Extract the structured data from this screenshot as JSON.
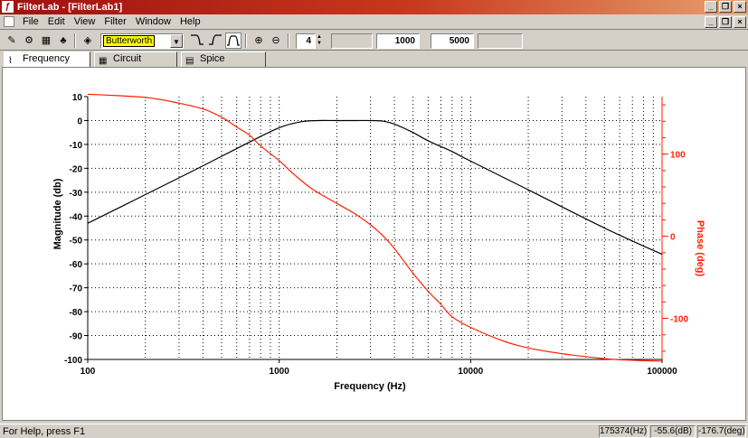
{
  "window": {
    "title": "FilterLab - [FilterLab1]",
    "controls": [
      "_",
      "❐",
      "×"
    ]
  },
  "menu": {
    "items": [
      "File",
      "Edit",
      "View",
      "Filter",
      "Window",
      "Help"
    ]
  },
  "toolbar": {
    "filter_type": "Butterworth",
    "order": "4",
    "low_freq": "1000",
    "high_freq": "5000"
  },
  "tabs": [
    {
      "label": "Frequency",
      "active": true
    },
    {
      "label": "Circuit",
      "active": false
    },
    {
      "label": "Spice",
      "active": false
    }
  ],
  "status": {
    "help": "For Help, press F1",
    "freq": "175374(Hz)",
    "mag": "-55.6(dB)",
    "phase": "-176.7(deg)"
  },
  "colors": {
    "magnitude": "#000000",
    "phase": "#ff2000",
    "grid": "#000000"
  },
  "chart_data": {
    "type": "line",
    "xlabel": "Frequency (Hz)",
    "ylabel": "Magnitude (db)",
    "y2label": "Phase (deg)",
    "xscale": "log",
    "xlim": [
      100,
      100000
    ],
    "ylim": [
      -100,
      10
    ],
    "y2lim": [
      -150,
      170
    ],
    "xticks": [
      100,
      1000,
      10000,
      100000
    ],
    "yticks": [
      10,
      0,
      -10,
      -20,
      -30,
      -40,
      -50,
      -60,
      -70,
      -80,
      -90,
      -100
    ],
    "y2ticks": [
      100,
      0,
      -100
    ],
    "grid": true,
    "series": [
      {
        "axis": "left",
        "color": "#000000",
        "x": [
          100,
          150,
          200,
          300,
          500,
          700,
          1000,
          1300,
          1600,
          2000,
          2500,
          3000,
          3500,
          4000,
          5000,
          6000,
          8000,
          10000,
          20000,
          50000,
          100000
        ],
        "y": [
          -43,
          -36,
          -31,
          -24,
          -15,
          -9,
          -3,
          -0.5,
          0,
          0,
          0,
          0,
          -0.3,
          -1.5,
          -5,
          -8.5,
          -13,
          -17,
          -29,
          -45,
          -56
        ]
      },
      {
        "axis": "right",
        "color": "#ff2000",
        "x": [
          100,
          200,
          300,
          400,
          500,
          600,
          700,
          800,
          1000,
          1200,
          1500,
          2000,
          2500,
          3000,
          3500,
          4000,
          5000,
          6000,
          7000,
          8000,
          10000,
          15000,
          20000,
          30000,
          50000,
          70000,
          100000
        ],
        "y": [
          173,
          169,
          162,
          155,
          145,
          133,
          123,
          110,
          92,
          75,
          57,
          40,
          27,
          14,
          0,
          -15,
          -45,
          -67,
          -83,
          -98,
          -111,
          -128,
          -136,
          -143,
          -149,
          -151,
          -152
        ]
      }
    ]
  }
}
